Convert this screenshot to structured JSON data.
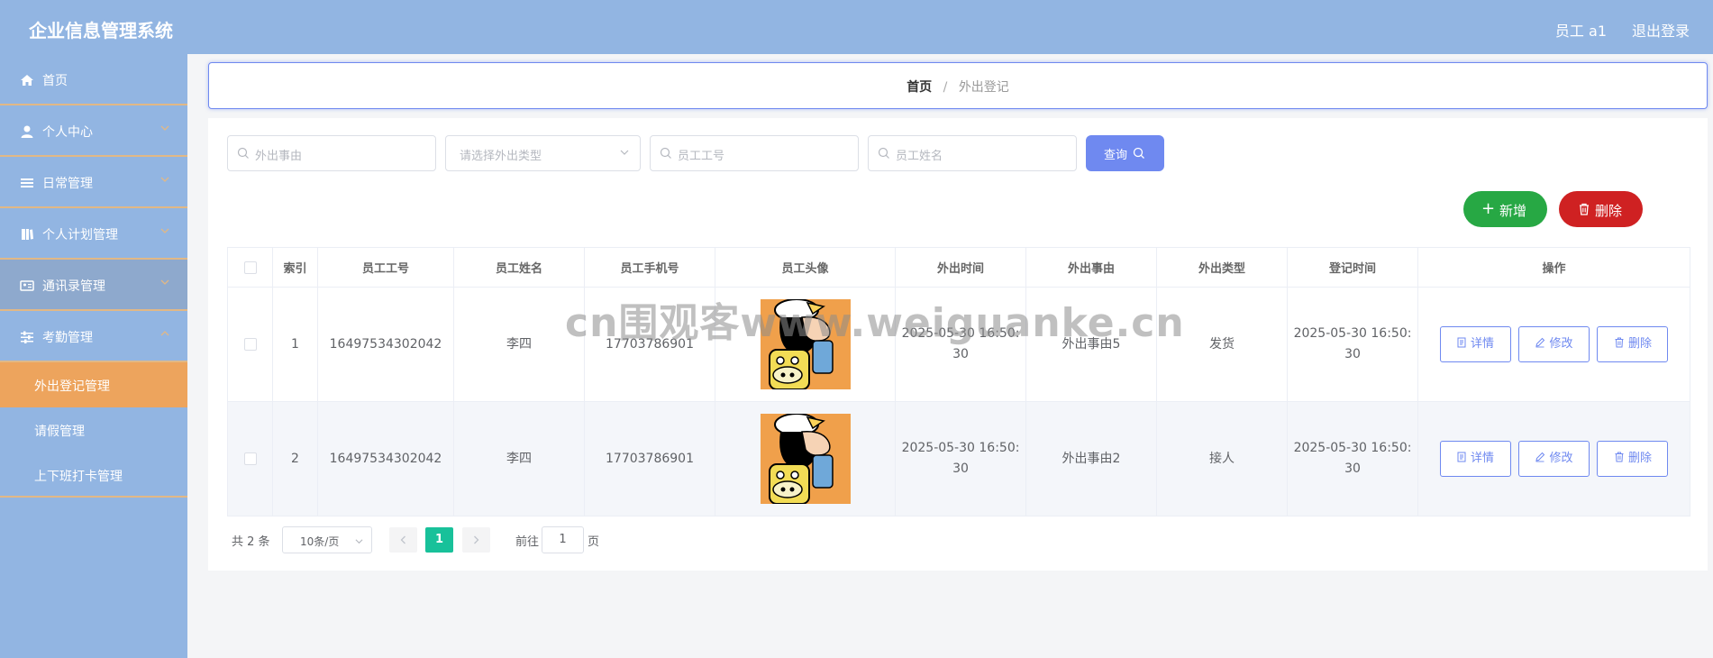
{
  "header": {
    "title": "企业信息管理系统",
    "user": "员工 a1",
    "logout": "退出登录"
  },
  "sidebar": {
    "items": [
      {
        "label": "首页",
        "icon": "home-icon"
      },
      {
        "label": "个人中心",
        "icon": "user-icon"
      },
      {
        "label": "日常管理",
        "icon": "list-icon"
      },
      {
        "label": "个人计划管理",
        "icon": "book-icon"
      },
      {
        "label": "通讯录管理",
        "icon": "contact-card-icon"
      },
      {
        "label": "考勤管理",
        "icon": "sliders-icon"
      }
    ],
    "subitems": [
      {
        "label": "外出登记管理",
        "active": true
      },
      {
        "label": "请假管理",
        "active": false
      },
      {
        "label": "上下班打卡管理",
        "active": false
      }
    ]
  },
  "breadcrumb": {
    "home": "首页",
    "separator": "/",
    "current": "外出登记"
  },
  "search": {
    "reason_placeholder": "外出事由",
    "type_placeholder": "请选择外出类型",
    "emp_no_placeholder": "员工工号",
    "emp_name_placeholder": "员工姓名",
    "query_label": "查询"
  },
  "actions": {
    "add_label": "新增",
    "delete_label": "删除"
  },
  "table": {
    "headers": [
      "索引",
      "员工工号",
      "员工姓名",
      "员工手机号",
      "员工头像",
      "外出时间",
      "外出事由",
      "外出类型",
      "登记时间",
      "操作"
    ],
    "rows": [
      {
        "index": "1",
        "emp_no": "16497534302042",
        "name": "李四",
        "phone": "17703786901",
        "out_time_1": "2025-05-30 16:50:",
        "out_time_2": "30",
        "reason": "外出事由5",
        "type": "发货",
        "reg_time_1": "2025-05-30 16:50:",
        "reg_time_2": "30"
      },
      {
        "index": "2",
        "emp_no": "16497534302042",
        "name": "李四",
        "phone": "17703786901",
        "out_time_1": "2025-05-30 16:50:",
        "out_time_2": "30",
        "reason": "外出事由2",
        "type": "接人",
        "reg_time_1": "2025-05-30 16:50:",
        "reg_time_2": "30"
      }
    ],
    "row_actions": {
      "detail": "详情",
      "edit": "修改",
      "delete": "删除"
    }
  },
  "pagination": {
    "total": "共 2 条",
    "page_size": "10条/页",
    "current_page": "1",
    "goto_prefix": "前往",
    "goto_value": "1",
    "goto_suffix": "页"
  },
  "watermark": "cn围观客www.weiguanke.cn",
  "colors": {
    "header_bg": "#92b5e2",
    "active_menu": "#eda45d",
    "primary": "#6f89f0",
    "add": "#27a844",
    "delete": "#cf2122",
    "page_active": "#18c19a"
  }
}
